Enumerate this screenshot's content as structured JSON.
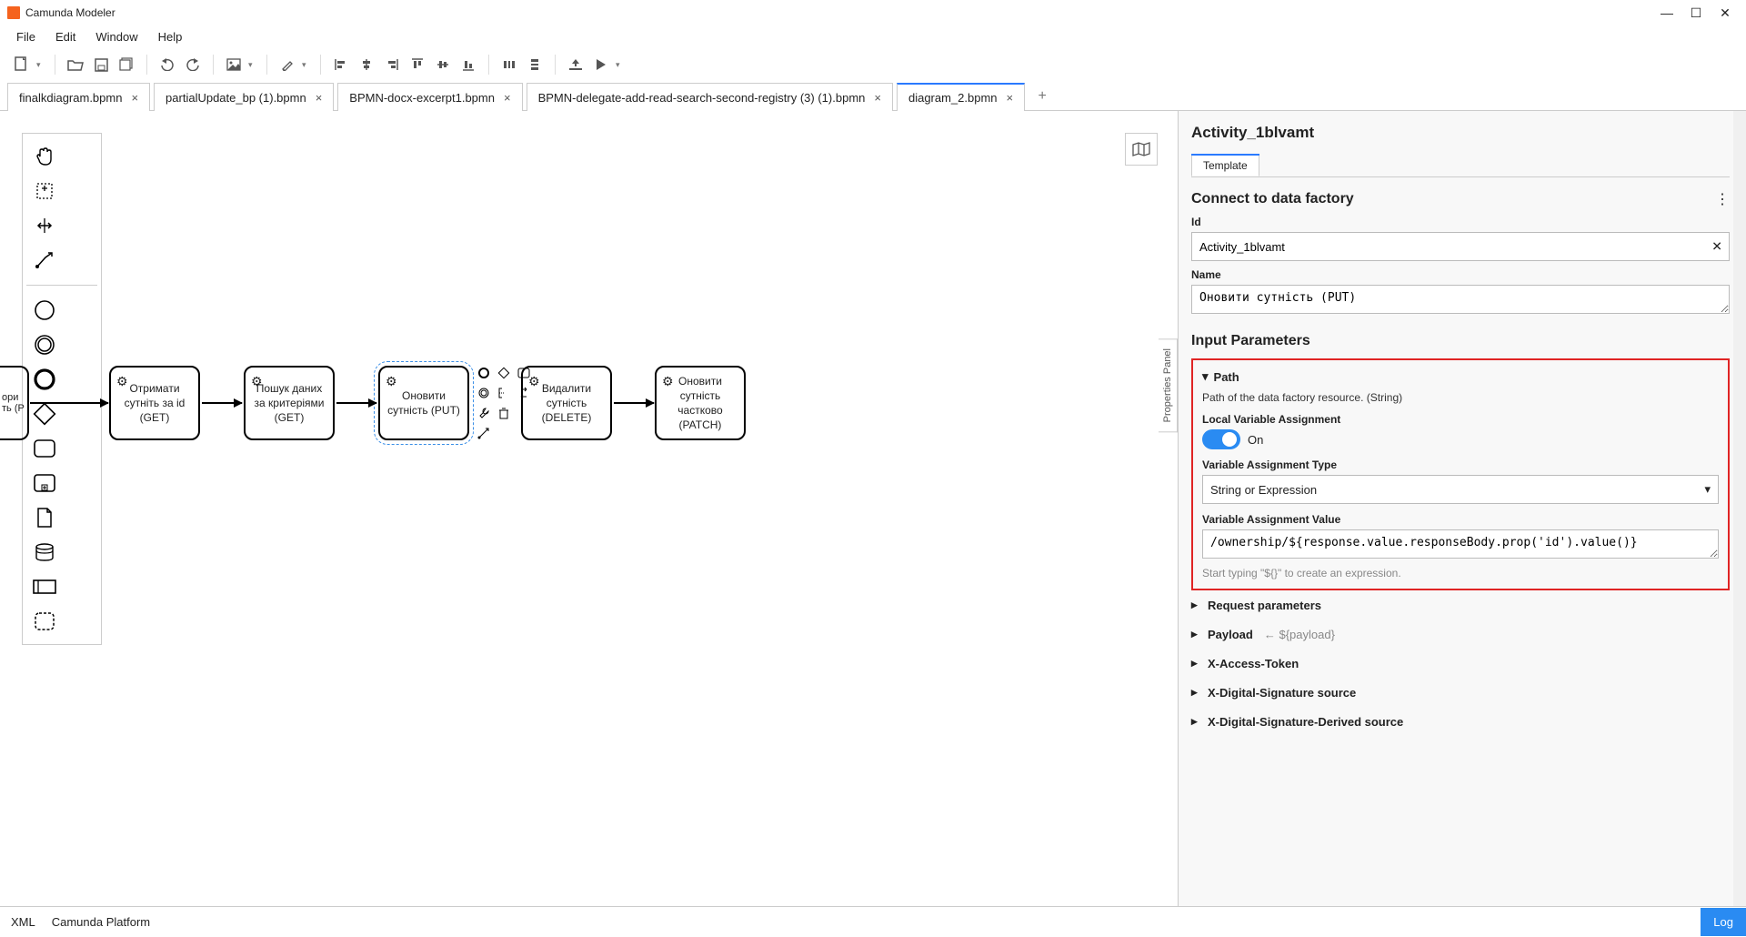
{
  "app": {
    "title": "Camunda Modeler"
  },
  "menu": {
    "file": "File",
    "edit": "Edit",
    "window": "Window",
    "help": "Help"
  },
  "tabs": [
    {
      "label": "finalkdiagram.bpmn"
    },
    {
      "label": "partialUpdate_bp (1).bpmn"
    },
    {
      "label": "BPMN-docx-excerpt1.bpmn"
    },
    {
      "label": "BPMN-delegate-add-read-search-second-registry (3) (1).bpmn"
    },
    {
      "label": "diagram_2.bpmn",
      "active": true
    }
  ],
  "tasks": {
    "clip": "ори\nть (P",
    "t1": "Отримати сутніть за id (GET)",
    "t2": "Пошук даних за критеріями (GET)",
    "t3": "Оновити сутність (PUT)",
    "t4": "Видалити сутність (DELETE)",
    "t5": "Оновити сутність частково (PATCH)"
  },
  "props": {
    "title": "Activity_1blvamt",
    "templateTab": "Template",
    "sectionTitle": "Connect to data factory",
    "idLabel": "Id",
    "idValue": "Activity_1blvamt",
    "nameLabel": "Name",
    "nameValue": "Оновити сутність (PUT)",
    "inputParamsTitle": "Input Parameters",
    "path": {
      "header": "Path",
      "desc": "Path of the data factory resource. (String)",
      "lvaLabel": "Local Variable Assignment",
      "lvaState": "On",
      "vatLabel": "Variable Assignment Type",
      "vatValue": "String or Expression",
      "vavLabel": "Variable Assignment Value",
      "vavValue": "/ownership/${response.value.responseBody.prop('id').value()}",
      "hint": "Start typing \"${}\" to create an expression."
    },
    "collapsed": {
      "req": "Request parameters",
      "payload": "Payload",
      "payloadSub": "←   ${payload}",
      "xat": "X-Access-Token",
      "xds": "X-Digital-Signature source",
      "xdsd": "X-Digital-Signature-Derived source"
    }
  },
  "panelTab": "Properties Panel",
  "bottom": {
    "xml": "XML",
    "platform": "Camunda Platform",
    "log": "Log"
  }
}
